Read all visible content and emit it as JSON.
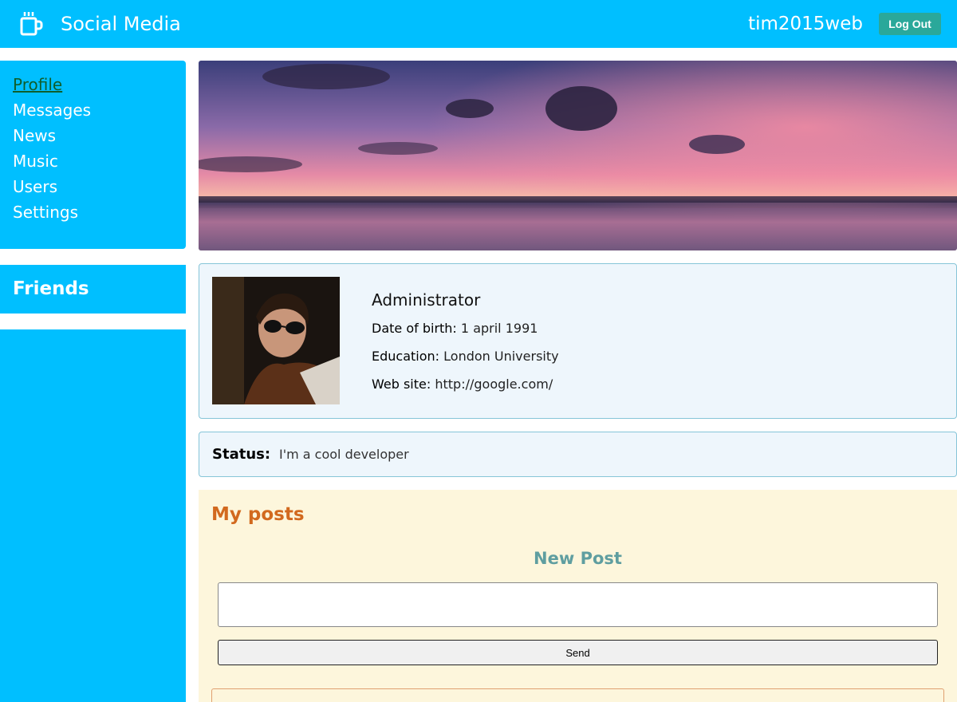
{
  "header": {
    "app_title": "Social Media",
    "logo_icon": "coffee-cup-icon",
    "username": "tim2015web",
    "logout_label": "Log Out"
  },
  "nav": {
    "items": [
      {
        "label": "Profile",
        "active": true
      },
      {
        "label": "Messages",
        "active": false
      },
      {
        "label": "News",
        "active": false
      },
      {
        "label": "Music",
        "active": false
      },
      {
        "label": "Users",
        "active": false
      },
      {
        "label": "Settings",
        "active": false
      }
    ]
  },
  "friends": {
    "title": "Friends"
  },
  "profile": {
    "name": "Administrator",
    "dob_label": "Date of birth:",
    "dob_value": "1 april 1991",
    "education_label": "Education:",
    "education_value": "London University",
    "website_label": "Web site:",
    "website_value": "http://google.com/"
  },
  "status": {
    "label": "Status:",
    "text": "I'm a cool developer"
  },
  "posts": {
    "title": "My posts",
    "new_post_title": "New Post",
    "input_value": "",
    "send_label": "Send"
  },
  "colors": {
    "accent": "#00bfff",
    "logout_bg": "#2aa89a",
    "posts_title": "#d2691e",
    "new_post_title": "#5f9ea0",
    "active_nav": "#0f5e2c"
  }
}
